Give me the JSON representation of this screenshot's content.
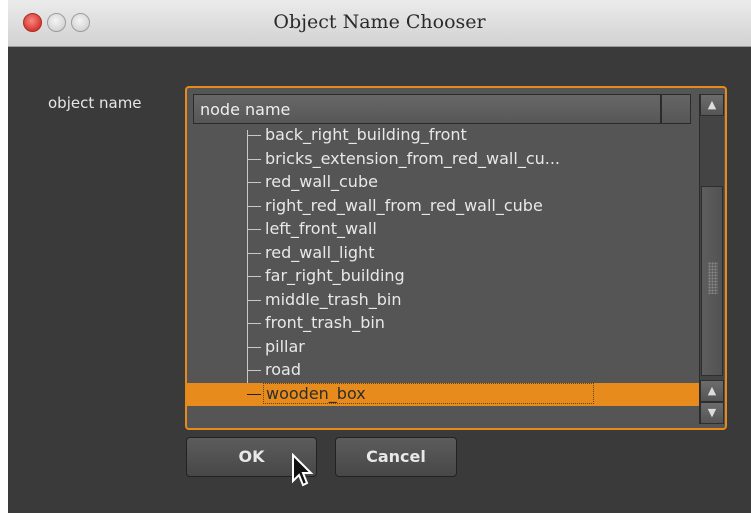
{
  "window": {
    "title": "Object Name Chooser"
  },
  "form": {
    "label": "object name"
  },
  "tree": {
    "header": "node name",
    "items": [
      "back_right_building_front",
      "bricks_extension_from_red_wall_cu...",
      "red_wall_cube",
      "right_red_wall_from_red_wall_cube",
      "left_front_wall",
      "red_wall_light",
      "far_right_building",
      "middle_trash_bin",
      "front_trash_bin",
      "pillar",
      "road",
      "wooden_box"
    ],
    "selected_index": 11
  },
  "buttons": {
    "ok": "OK",
    "cancel": "Cancel"
  },
  "colors": {
    "accent": "#e88b1d",
    "background": "#3a3a3a",
    "panel": "#555555"
  },
  "icons": {
    "scroll_up": "triangle-up-icon",
    "scroll_down": "triangle-down-icon"
  }
}
